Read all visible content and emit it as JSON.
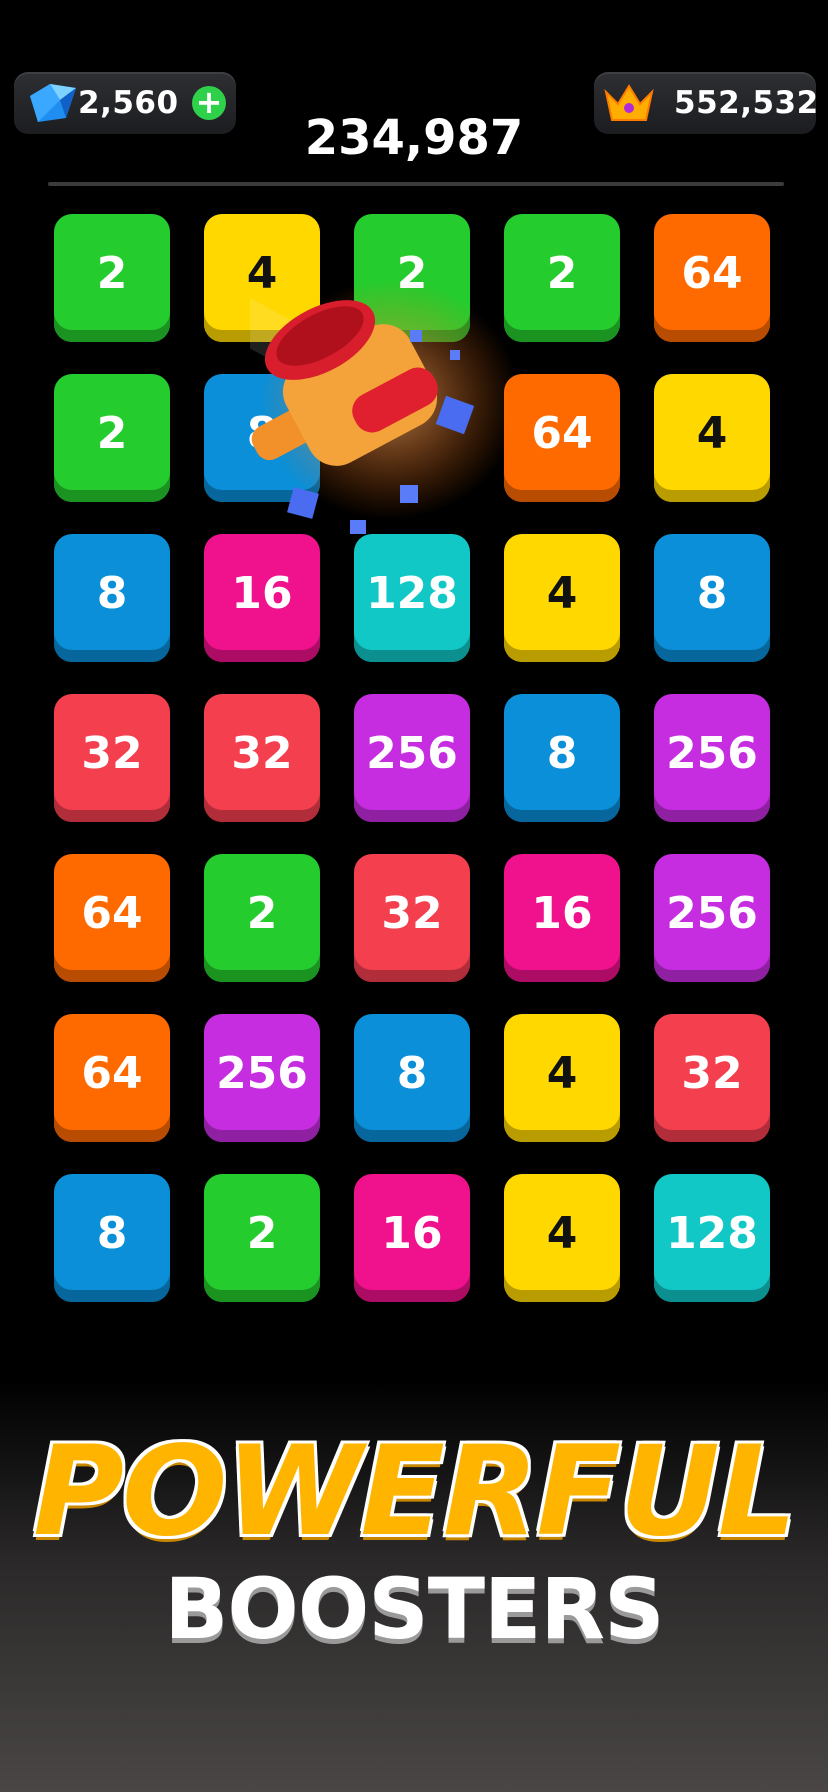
{
  "hud": {
    "gems": "2,560",
    "gems_icon": "diamond-icon",
    "add_gems_icon": "plus-icon",
    "best": "552,532",
    "best_icon": "crown-icon",
    "score": "234,987"
  },
  "board": {
    "rows": [
      [
        "2",
        "4",
        "2",
        "2",
        "64"
      ],
      [
        "2",
        "8",
        "",
        "64",
        "4"
      ],
      [
        "8",
        "16",
        "128",
        "4",
        "8"
      ],
      [
        "32",
        "32",
        "256",
        "8",
        "256"
      ],
      [
        "64",
        "2",
        "32",
        "16",
        "256"
      ],
      [
        "64",
        "256",
        "8",
        "4",
        "32"
      ],
      [
        "8",
        "2",
        "16",
        "4",
        "128"
      ]
    ],
    "tile_colors": {
      "2": "#25cc2e",
      "4": "#ffd800",
      "8": "#0a8fd8",
      "16": "#f0118c",
      "32": "#f43f4f",
      "64": "#ff6a00",
      "128": "#11c8c6",
      "256": "#c62de0"
    },
    "booster": "hammer-icon"
  },
  "promo": {
    "headline": "POWERFUL",
    "subline": "BOOSTERS"
  }
}
